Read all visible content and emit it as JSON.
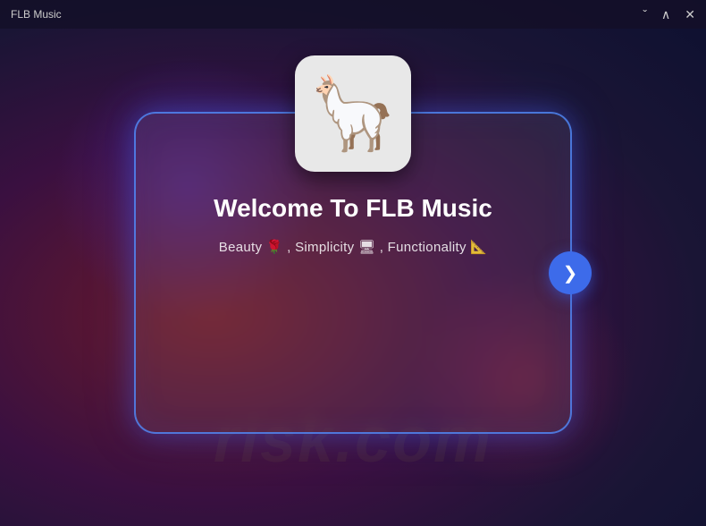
{
  "titleBar": {
    "title": "FLB Music",
    "controls": {
      "minimize": "ˇ",
      "maximize": "∧",
      "close": "✕"
    }
  },
  "card": {
    "appIconEmoji": "🦙",
    "welcomeTitle": "Welcome To FLB Music",
    "subtitle": "Beauty 🌹 , Simplicity 🖥 , Functionality 📐",
    "nextButtonLabel": "❯"
  },
  "watermark": {
    "line1": "risk.com"
  }
}
